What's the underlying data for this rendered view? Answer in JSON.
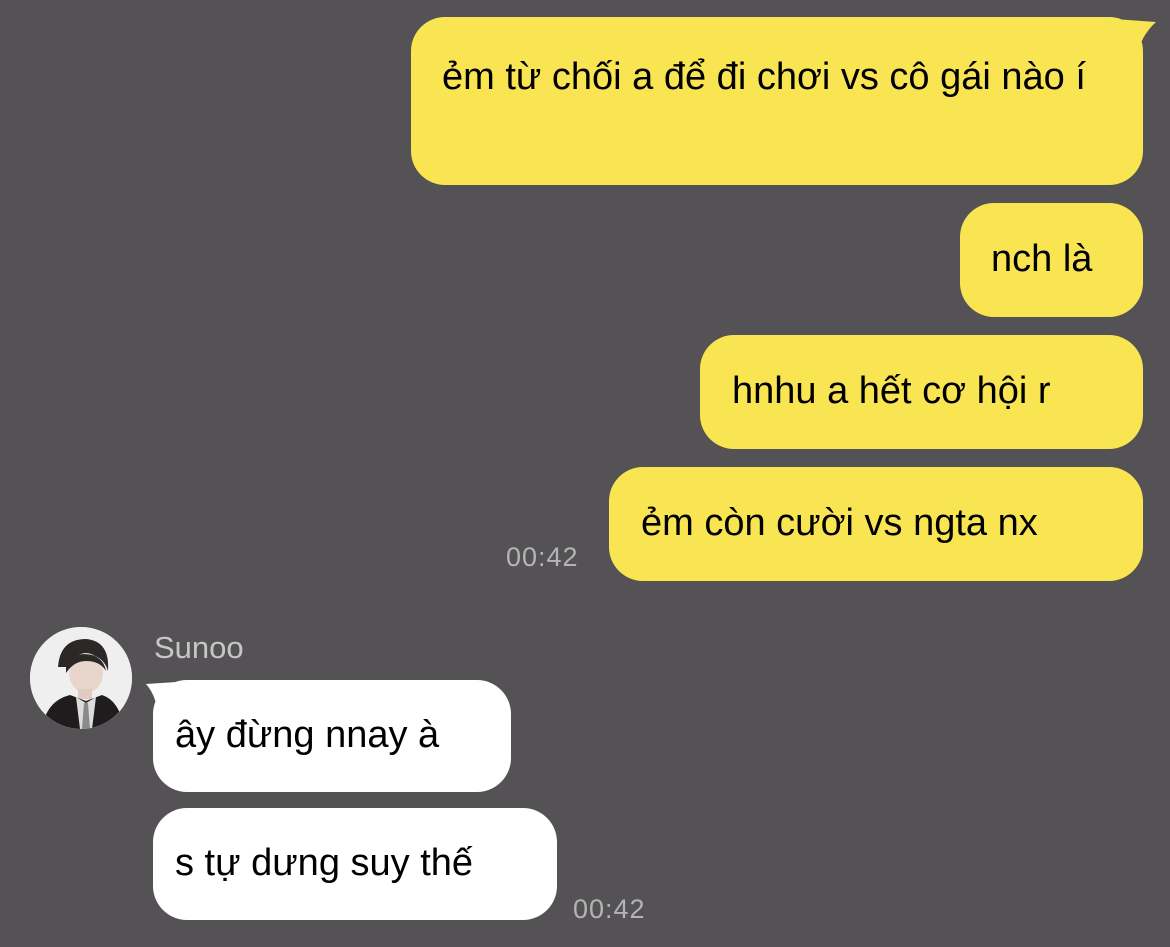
{
  "chat": {
    "outgoing": [
      {
        "text": "ẻm từ chối a để đi chơi vs cô gái nào í"
      },
      {
        "text": "nch là"
      },
      {
        "text": "hnhu a hết cơ hội r"
      },
      {
        "text": "ẻm còn cười vs ngta nx"
      }
    ],
    "outgoing_time": "00:42",
    "contact": {
      "name": "Sunoo",
      "avatar_icon": "profile-photo"
    },
    "incoming": [
      {
        "text": "ây đừng nnay à"
      },
      {
        "text": "s tự dưng suy thế"
      }
    ],
    "incoming_time": "00:42"
  },
  "colors": {
    "background": "#545255",
    "outgoing_bubble": "#f9e552",
    "incoming_bubble": "#ffffff",
    "timestamp": "#b4b4b4",
    "name": "#c6c6c6"
  }
}
